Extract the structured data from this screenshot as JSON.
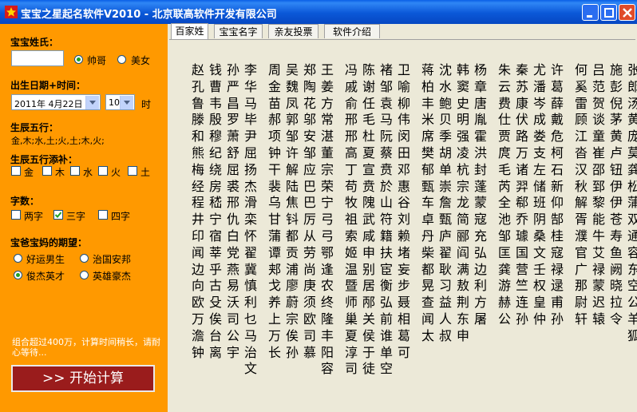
{
  "window": {
    "title": "宝宝之星起名软件V2010  -  北京联高软件开发有限公司",
    "app_icon": "baby-star-icon",
    "controls": [
      "minimize-icon",
      "maximize-icon",
      "close-icon"
    ]
  },
  "sidebar": {
    "surname_label": "宝宝姓氏：",
    "surname_value": "",
    "gender": {
      "options": [
        "帅哥",
        "美女"
      ],
      "selected": "帅哥"
    },
    "birth_label": "出生日期+时间：",
    "date_value": "2011年 4月22日",
    "hour_value": "10",
    "hour_unit": "时",
    "wuxing_label": "生辰五行：",
    "wuxing_value": "金,木;水,土;火,土;木,火;",
    "wuxing_add_label": "生辰五行添补：",
    "elements": [
      {
        "label": "金",
        "checked": false
      },
      {
        "label": "木",
        "checked": false
      },
      {
        "label": "水",
        "checked": false
      },
      {
        "label": "火",
        "checked": false
      },
      {
        "label": "土",
        "checked": false
      }
    ],
    "charcount_label": "字数：",
    "charcounts": [
      {
        "label": "两字",
        "checked": false
      },
      {
        "label": "三字",
        "checked": true
      },
      {
        "label": "四字",
        "checked": false
      }
    ],
    "hope_label": "宝爸宝妈的期望：",
    "hopes": [
      {
        "label": "好运男生",
        "selected": false
      },
      {
        "label": "治国安邦",
        "selected": false
      },
      {
        "label": "俊杰英才",
        "selected": true
      },
      {
        "label": "英雄豪杰",
        "selected": false
      }
    ],
    "note": "组合超过400万，计算时间稍长，请耐心等待...",
    "start_button": ">> 开始计算"
  },
  "tabs": [
    {
      "label": "百家姓",
      "active": true
    },
    {
      "label": "宝宝名字",
      "active": false
    },
    {
      "label": "亲友投票",
      "active": false
    },
    {
      "label": "软件介绍",
      "active": false
    }
  ],
  "surnames_columns": [
    "赵孔鲁滕和熊梅经程井印闻边向欧万澹钟",
    "钱曹韦殷穆纪绕房嵇宁宿莘乎古殳俟台离",
    "孙严昌罗萧舒屈裘邢仇白党燕易沃司公宇",
    "李华马毕尹屈扬杰滑栾怀翟冀慎利乜马治文",
    "",
    "周金苗郝项钟干裴乌甘蒲谭郏戈养上万长",
    "吴魏凤郭邹许解陆焦钭都贡浦廖蔚宗俟孙",
    "郑陶花邬安邹应巴巴厉从劳尚庚须欧司慕",
    "王姜方常湛董宗荣宁弓弓鄂逢农终隆丰阳容",
    "",
    "冯戚俞邢邢高丁苟牧祖索姬温暨师巢夏淳司",
    "陈谢任毛杜夏宣贲隗武咸申别居邴关侯于徒",
    "褚邹袁马阮蔡贲於山符籍扶宦衡弘前谁单空",
    "卫喻柳伟闵田邓惠谷刘赖堵妄步聂相葛可",
    "",
    "蒋柏丰米席樊郁甄车卓丹柴都晃查闻太",
    "沈水鲍贝季胡单崇詹甄庐翟耿习益人叔",
    "韩窦史明强凌杭宗龙简郦阎满敖荆东申",
    "杨章唐胤霍洪封蓬蒙寇充弘边利方屠",
    "",
    "朱云费仕贾庹毛芮全池邹匡龚游赫公",
    "秦苏康伏路万诸羿郗乔璩国营竺连孙",
    "尤潘岑成娄支左储班阴桑文壬权皇仲",
    "许葛薛戴危柯石新仰郜桂寇禄逯甫孙",
    "",
    "何奚雷顾江沓汉秋解胥濮官广那尉轩",
    "吕范贺谈童崔邵郅黎能牛艾禄蒙迟辕",
    "施彭倪茅黄卢钮伊伊苍寿鱼阙晓拉令",
    "张郎汤黄庞莫龚松蒲双通容东空公羊狐"
  ]
}
